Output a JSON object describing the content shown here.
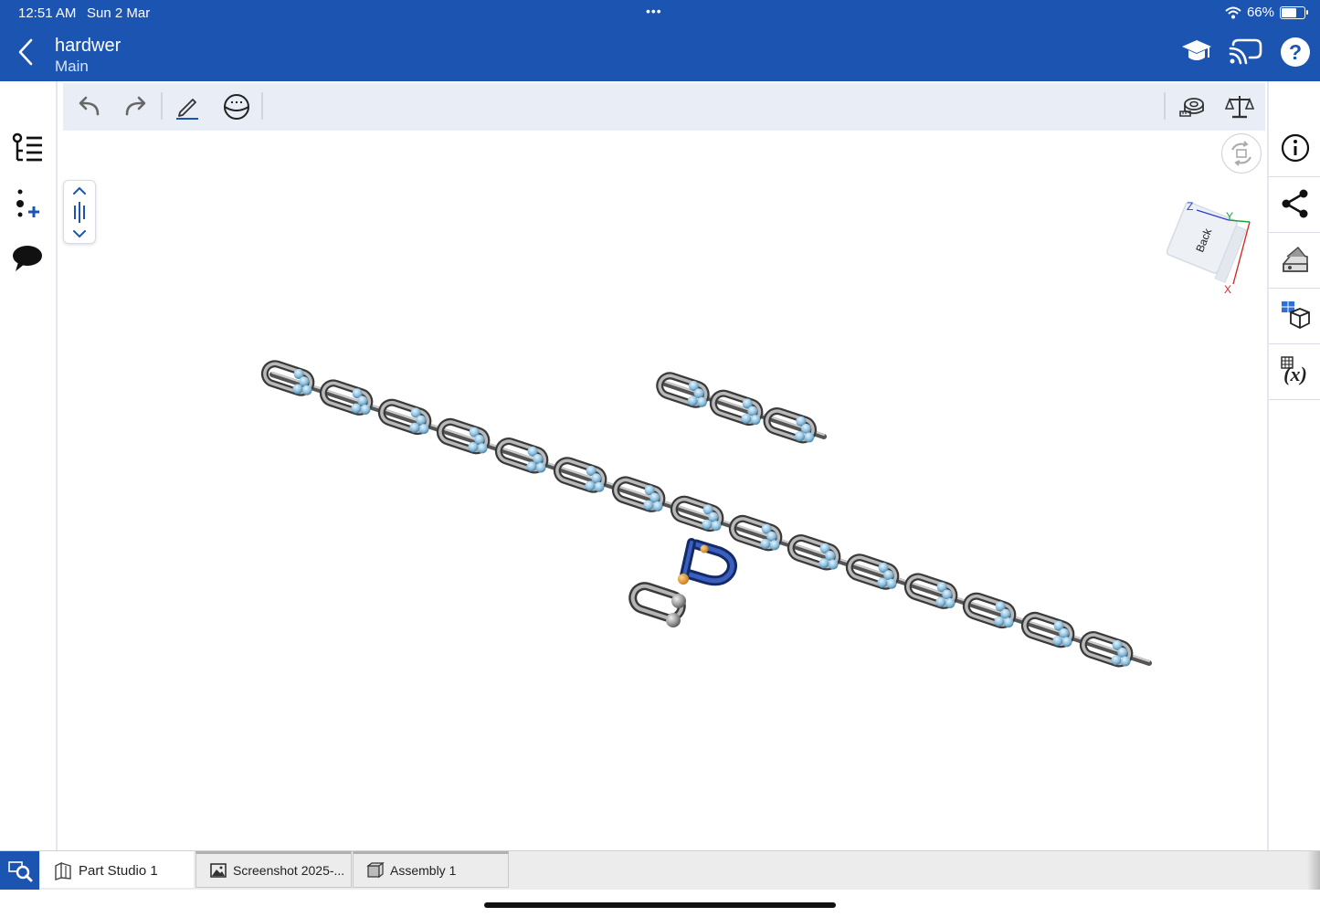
{
  "status": {
    "time": "12:51 AM",
    "date": "Sun 2 Mar",
    "battery": "66%",
    "dots": "•••"
  },
  "header": {
    "title": "hardwer",
    "subtitle": "Main"
  },
  "viewcube": {
    "face": "Back",
    "axis_x": "X",
    "axis_y": "Y",
    "axis_z": "Z"
  },
  "tabs": [
    {
      "label": "Part Studio 1",
      "icon": "part-studio-icon"
    },
    {
      "label": "Screenshot 2025-...",
      "icon": "image-icon"
    },
    {
      "label": "Assembly 1",
      "icon": "assembly-icon"
    }
  ],
  "colors": {
    "brand": "#1c54b2",
    "toolbar": "#e9eef6",
    "link_gray": "#8c8c8c",
    "link_pin": "#8fc1e0",
    "shackle": "#23428f",
    "shackle_pin": "#e0901e"
  }
}
